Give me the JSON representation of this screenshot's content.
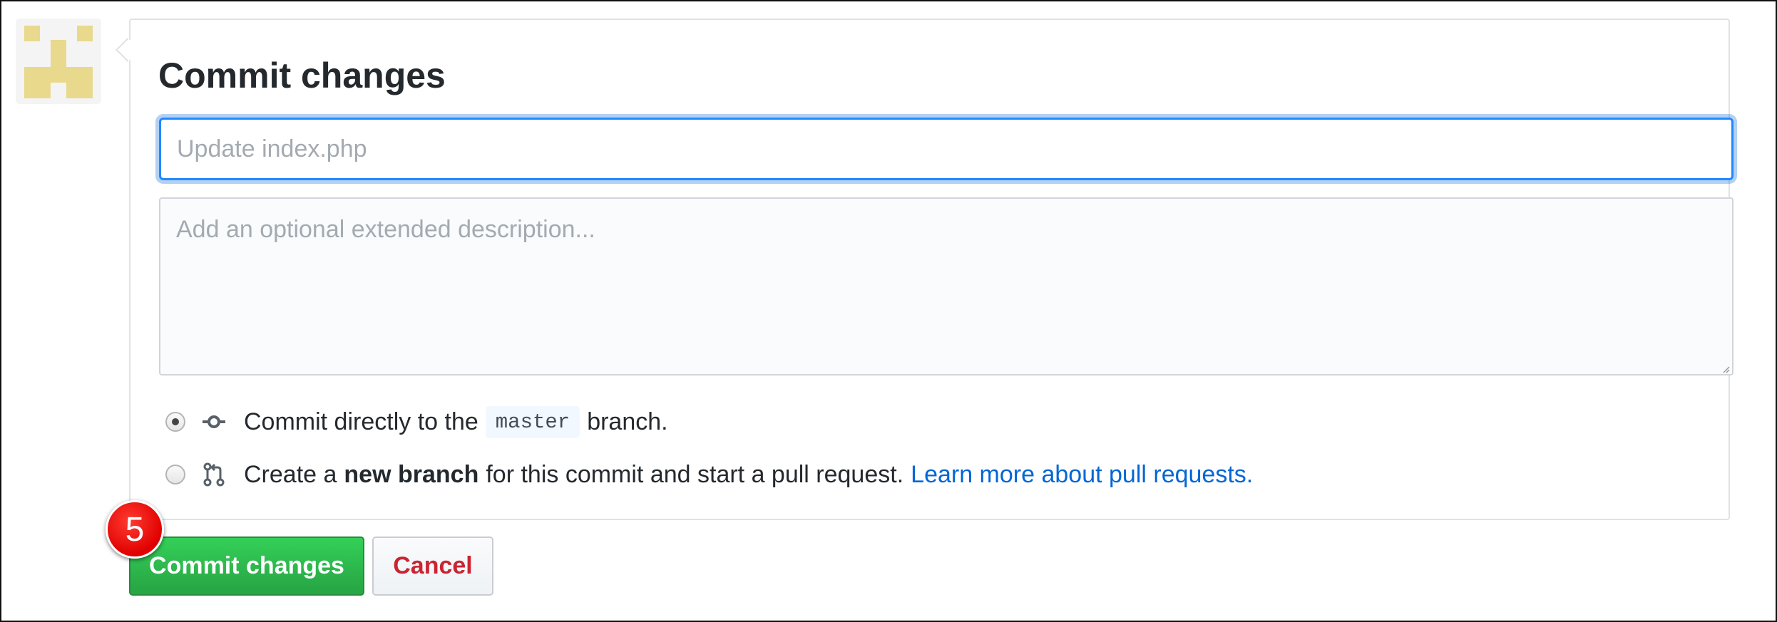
{
  "form": {
    "title": "Commit changes",
    "summary_placeholder": "Update index.php",
    "description_placeholder": "Add an optional extended description..."
  },
  "options": {
    "direct": {
      "prefix": "Commit directly to the",
      "branch": "master",
      "suffix": "branch.",
      "selected": true
    },
    "new_branch": {
      "prefix": "Create a",
      "bold": "new branch",
      "suffix": "for this commit and start a pull request.",
      "link": "Learn more about pull requests.",
      "selected": false
    }
  },
  "buttons": {
    "commit": "Commit changes",
    "cancel": "Cancel"
  },
  "callout": {
    "step": "5"
  },
  "colors": {
    "primary_button": "#28a745",
    "cancel_text": "#cb2431",
    "link": "#0366d6",
    "focus_border": "#2188ff",
    "callout_badge": "#e00000"
  },
  "icons": {
    "commit_option": "git-commit-icon",
    "branch_option": "git-pull-request-icon",
    "avatar": "identicon-avatar"
  }
}
